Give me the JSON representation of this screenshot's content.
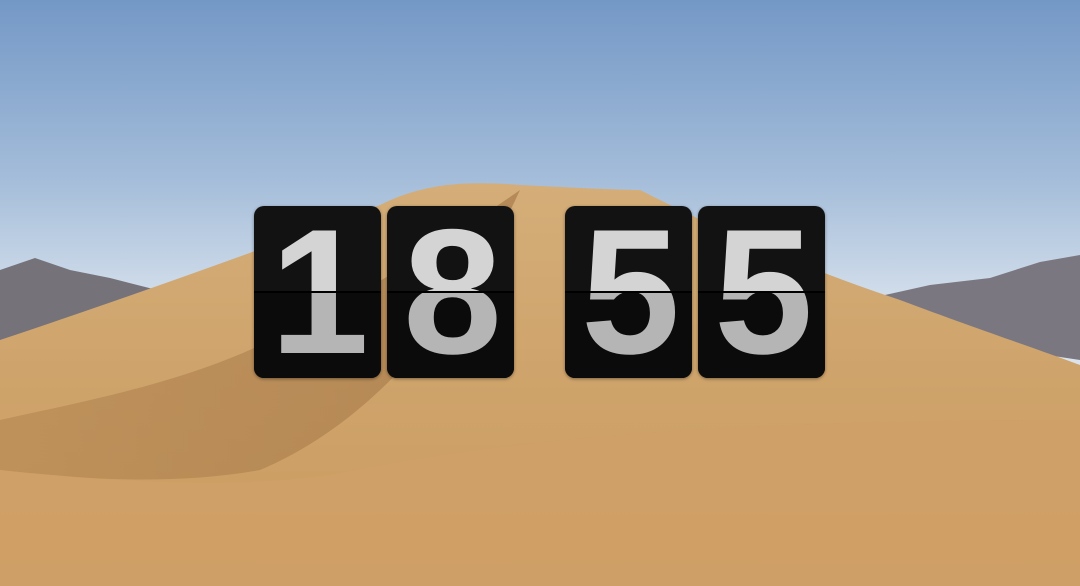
{
  "clock": {
    "digits": [
      "1",
      "8",
      "5",
      "5"
    ],
    "card_color": "#121212",
    "digit_color": "#d4d4d4"
  }
}
